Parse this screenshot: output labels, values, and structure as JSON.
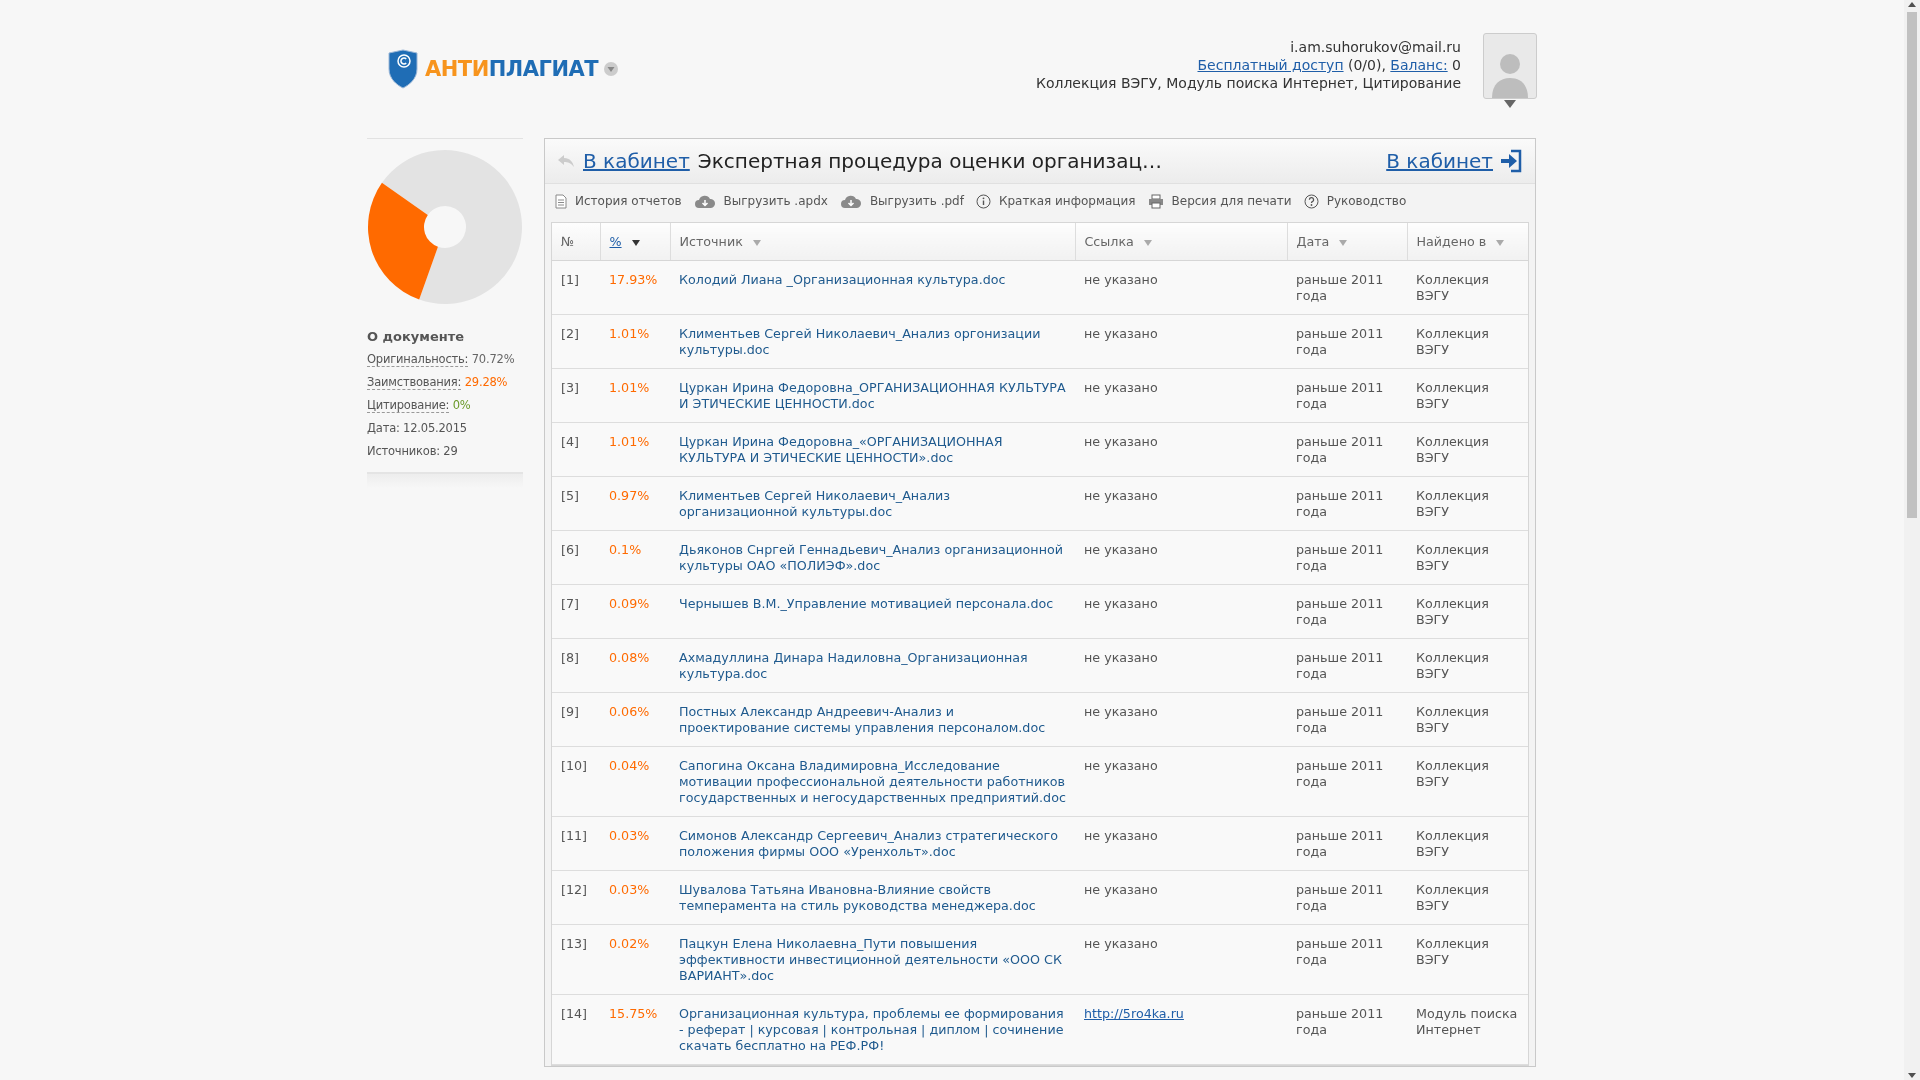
{
  "header": {
    "logo": {
      "prefix": "АНТИ",
      "suffix": "ПЛАГИАТ"
    },
    "account": {
      "email": "i.am.suhorukov@mail.ru",
      "access_link": "Бесплатный доступ",
      "access_count": " (0/0), ",
      "balance_link": "Баланс:",
      "balance_value": " 0",
      "services": "Коллекция ВЭГУ, Модуль поиска Интернет, Цитирование"
    }
  },
  "sidebar": {
    "chart_data": {
      "type": "donut",
      "values": [
        70.72,
        29.28,
        0
      ]
    },
    "heading": "О документе",
    "items": [
      {
        "kind": "metric",
        "label": "Оригинальность:",
        "value": "70.72%",
        "color": "#666666"
      },
      {
        "kind": "metric",
        "label": "Заимствования:",
        "value": "29.28%",
        "color": "#ff6a00"
      },
      {
        "kind": "metric",
        "label": "Цитирование:",
        "value": "0%",
        "color": "#6b9a2a"
      },
      {
        "kind": "plain",
        "text": "Дата: 12.05.2015"
      },
      {
        "kind": "plain",
        "text": "Источников: 29"
      }
    ]
  },
  "panel": {
    "back_link": "В кабинет",
    "title": "Экспертная процедура оценки организац…",
    "cabinet_link": "В кабинет",
    "toolbar": [
      {
        "kind": "history",
        "label": "История отчетов"
      },
      {
        "kind": "export",
        "label": "Выгрузить .apdx"
      },
      {
        "kind": "export",
        "label": "Выгрузить .pdf"
      },
      {
        "kind": "info",
        "label": "Краткая информация"
      },
      {
        "kind": "print",
        "label": "Версия для печати"
      },
      {
        "kind": "help",
        "label": "Руководство"
      }
    ],
    "table": {
      "columns": [
        {
          "label": "№",
          "kind": "plain"
        },
        {
          "label": "%",
          "kind": "sort",
          "sorted": true
        },
        {
          "label": "Источник",
          "kind": "sort",
          "sorted": false
        },
        {
          "label": "Ссылка",
          "kind": "sort",
          "sorted": false
        },
        {
          "label": "Дата",
          "kind": "sort",
          "sorted": false
        },
        {
          "label": "Найдено в",
          "kind": "sort",
          "sorted": false
        }
      ],
      "rows": [
        {
          "num": "[1]",
          "percent": "17.93%",
          "source": "Колодий Лиана _Организационная культура.doc",
          "link": {
            "kind": "none",
            "text": "не указано"
          },
          "date": "раньше 2011 года",
          "found_in": "Коллекция ВЭГУ"
        },
        {
          "num": "[2]",
          "percent": "1.01%",
          "source": "Климентьев Сергей Николаевич_Анализ оргонизации культуры.doc",
          "link": {
            "kind": "none",
            "text": "не указано"
          },
          "date": "раньше 2011 года",
          "found_in": "Коллекция ВЭГУ"
        },
        {
          "num": "[3]",
          "percent": "1.01%",
          "source": "Цуркан Ирина Федоровна_ОРГАНИЗАЦИОННАЯ КУЛЬТУРА И ЭТИЧЕСКИЕ ЦЕННОСТИ.doc",
          "link": {
            "kind": "none",
            "text": "не указано"
          },
          "date": "раньше 2011 года",
          "found_in": "Коллекция ВЭГУ"
        },
        {
          "num": "[4]",
          "percent": "1.01%",
          "source": "Цуркан Ирина Федоровна_«ОРГАНИЗАЦИОННАЯ КУЛЬТУРА И ЭТИЧЕСКИЕ ЦЕННОСТИ».doc",
          "link": {
            "kind": "none",
            "text": "не указано"
          },
          "date": "раньше 2011 года",
          "found_in": "Коллекция ВЭГУ"
        },
        {
          "num": "[5]",
          "percent": "0.97%",
          "source": "Климентьев Сергей Николаевич_Анализ организационной культуры.doc",
          "link": {
            "kind": "none",
            "text": "не указано"
          },
          "date": "раньше 2011 года",
          "found_in": "Коллекция ВЭГУ"
        },
        {
          "num": "[6]",
          "percent": "0.1%",
          "source": "Дьяконов Снргей Геннадьевич_Анализ организационной культуры ОАО «ПОЛИЭФ».doc",
          "link": {
            "kind": "none",
            "text": "не указано"
          },
          "date": "раньше 2011 года",
          "found_in": "Коллекция ВЭГУ"
        },
        {
          "num": "[7]",
          "percent": "0.09%",
          "source": "Чернышев В.М._Управление мотивацией персонала.doc",
          "link": {
            "kind": "none",
            "text": "не указано"
          },
          "date": "раньше 2011 года",
          "found_in": "Коллекция ВЭГУ"
        },
        {
          "num": "[8]",
          "percent": "0.08%",
          "source": "Ахмадуллина Динара Надиловна_Организационная культура.doc",
          "link": {
            "kind": "none",
            "text": "не указано"
          },
          "date": "раньше 2011 года",
          "found_in": "Коллекция ВЭГУ"
        },
        {
          "num": "[9]",
          "percent": "0.06%",
          "source": "Постных Александр Андреевич-Анализ и проектирование системы управления персоналом.doc",
          "link": {
            "kind": "none",
            "text": "не указано"
          },
          "date": "раньше 2011 года",
          "found_in": "Коллекция ВЭГУ"
        },
        {
          "num": "[10]",
          "percent": "0.04%",
          "source": "Сапогина Оксана Владимировна_Исследование мотивации профессиональной деятельности работников государственных и негосударственных предприятий.doc",
          "link": {
            "kind": "none",
            "text": "не указано"
          },
          "date": "раньше 2011 года",
          "found_in": "Коллекция ВЭГУ"
        },
        {
          "num": "[11]",
          "percent": "0.03%",
          "source": "Симонов Александр Сергеевич_Анализ стратегического положения фирмы ООО «Уренхольт».doc",
          "link": {
            "kind": "none",
            "text": "не указано"
          },
          "date": "раньше 2011 года",
          "found_in": "Коллекция ВЭГУ"
        },
        {
          "num": "[12]",
          "percent": "0.03%",
          "source": "Шувалова Татьяна Ивановна-Влияние свойств темперамента на стиль руководства менеджера.doc",
          "link": {
            "kind": "none",
            "text": "не указано"
          },
          "date": "раньше 2011 года",
          "found_in": "Коллекция ВЭГУ"
        },
        {
          "num": "[13]",
          "percent": "0.02%",
          "source": "Пацкун Елена Николаевна_Пути повышения эффективности инвестиционной деятельности «ООО СК ВАРИАНТ».doc",
          "link": {
            "kind": "none",
            "text": "не указано"
          },
          "date": "раньше 2011 года",
          "found_in": "Коллекция ВЭГУ"
        },
        {
          "num": "[14]",
          "percent": "15.75%",
          "source": "Организационная культура, проблемы ее формирования - реферат | курсовая | контрольная | диплом | сочинение скачать бесплатно на РЕФ.РФ!",
          "link": {
            "kind": "url",
            "text": "http://5ro4ka.ru"
          },
          "date": "раньше 2011 года",
          "found_in": "Модуль поиска Интернет"
        }
      ]
    }
  }
}
